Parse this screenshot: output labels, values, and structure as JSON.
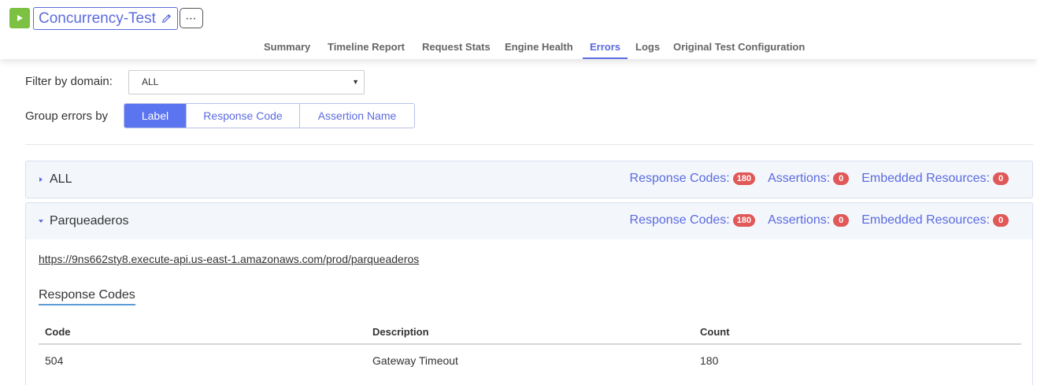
{
  "header": {
    "title": "Concurrency-Test",
    "more_label": "⋯",
    "run_icon": "play-icon",
    "edit_icon": "pencil-icon",
    "run_color": "#7cc142",
    "accent_color": "#5b6be0"
  },
  "tabs": [
    {
      "label": "Summary",
      "active": false
    },
    {
      "label": "Timeline Report",
      "active": false
    },
    {
      "label": "Request Stats",
      "active": false
    },
    {
      "label": "Engine Health",
      "active": false
    },
    {
      "label": "Errors",
      "active": true
    },
    {
      "label": "Logs",
      "active": false
    },
    {
      "label": "Original Test Configuration",
      "active": false
    }
  ],
  "filters": {
    "domain_label": "Filter by domain:",
    "domain_value": "ALL",
    "group_label": "Group errors by",
    "group_options": [
      "Label",
      "Response Code",
      "Assertion Name"
    ],
    "group_selected": "Label"
  },
  "panels": [
    {
      "name": "ALL",
      "expanded": false,
      "response_codes_label": "Response Codes:",
      "response_codes_count": "180",
      "assertions_label": "Assertions:",
      "assertions_count": "0",
      "embedded_label": "Embedded Resources:",
      "embedded_count": "0"
    },
    {
      "name": "Parqueaderos",
      "expanded": true,
      "response_codes_label": "Response Codes:",
      "response_codes_count": "180",
      "assertions_label": "Assertions:",
      "assertions_count": "0",
      "embedded_label": "Embedded Resources:",
      "embedded_count": "0",
      "url": "https://9ns662sty8.execute-api.us-east-1.amazonaws.com/prod/parqueaderos",
      "section_title": "Response Codes",
      "table": {
        "headers": [
          "Code",
          "Description",
          "Count"
        ],
        "rows": [
          [
            "504",
            "Gateway Timeout",
            "180"
          ]
        ]
      }
    }
  ],
  "badge_color": "#e05858"
}
